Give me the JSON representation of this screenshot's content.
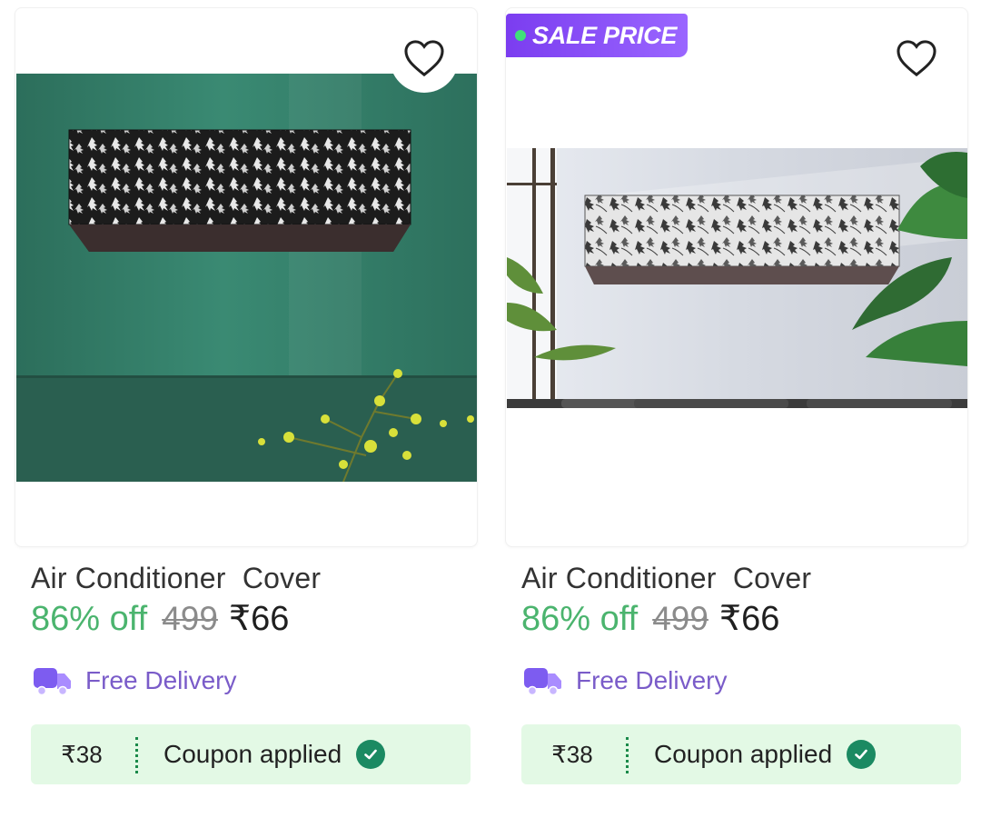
{
  "products": [
    {
      "title": "Air Conditioner  Cover",
      "discount": "86% off",
      "mrp": "499",
      "price": "₹66",
      "delivery": "Free Delivery",
      "coupon_amount": "₹38",
      "coupon_text": "Coupon applied",
      "badge": null,
      "image": "ac-cover-green-wall"
    },
    {
      "title": "Air Conditioner  Cover",
      "discount": "86% off",
      "mrp": "499",
      "price": "₹66",
      "delivery": "Free Delivery",
      "coupon_amount": "₹38",
      "coupon_text": "Coupon applied",
      "badge": "SALE PRICE",
      "image": "ac-cover-grey-wall"
    }
  ],
  "icons": {
    "wishlist": "heart-outline-icon",
    "delivery": "truck-icon",
    "coupon": "check-circle-icon"
  },
  "colors": {
    "discount": "#4bb46e",
    "delivery": "#7a5cc9",
    "coupon_bg": "#e3f9e5",
    "badge": "#8a52f7"
  }
}
